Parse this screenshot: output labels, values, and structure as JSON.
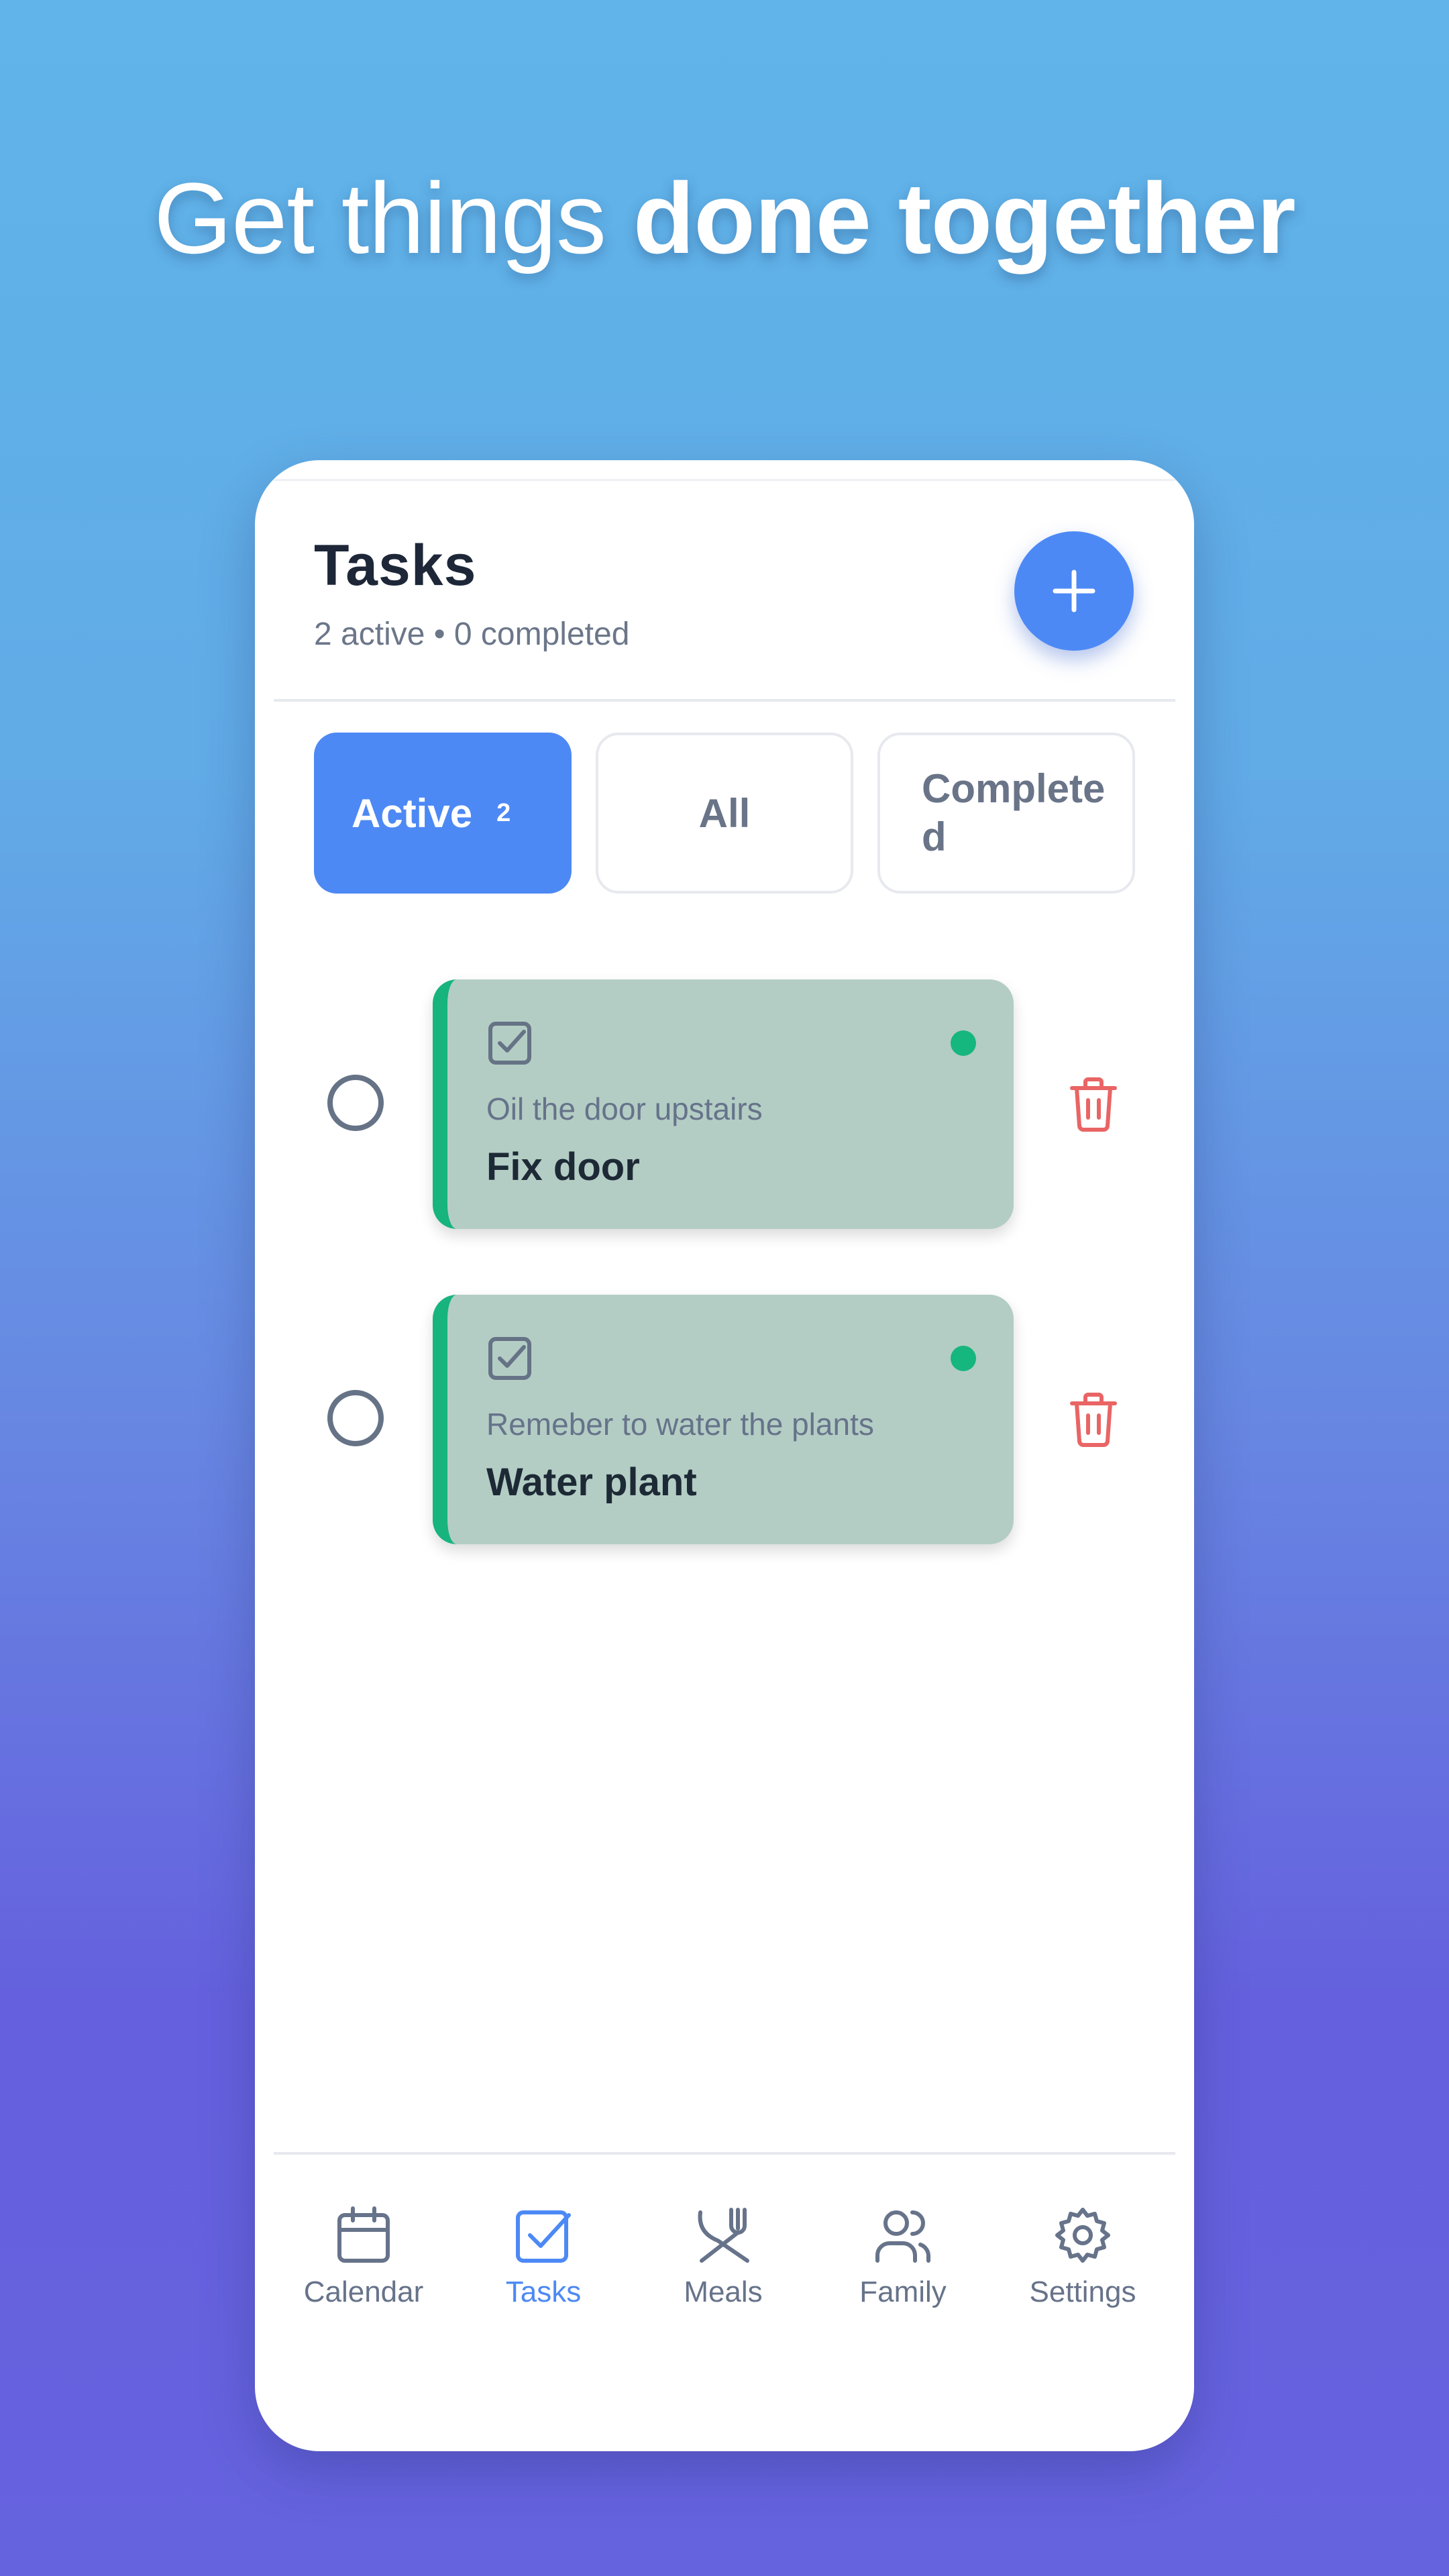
{
  "hero": {
    "light": "Get things",
    "bold": "done together"
  },
  "header": {
    "title": "Tasks",
    "subtitle": "2 active • 0 completed",
    "add_icon": "plus-icon"
  },
  "filters": {
    "active_label": "Active",
    "active_count": "2",
    "all_label": "All",
    "completed_label": "Completed"
  },
  "tasks": [
    {
      "description": "Oil the door upstairs",
      "name": "Fix door",
      "icon": "checkbox-icon",
      "status_color": "#16b67f"
    },
    {
      "description": "Remeber to water the plants",
      "name": "Water plant",
      "icon": "checkbox-icon",
      "status_color": "#16b67f"
    }
  ],
  "nav": [
    {
      "label": "Calendar",
      "icon": "calendar-icon"
    },
    {
      "label": "Tasks",
      "icon": "task-check-icon"
    },
    {
      "label": "Meals",
      "icon": "utensils-crossed-icon"
    },
    {
      "label": "Family",
      "icon": "users-icon"
    },
    {
      "label": "Settings",
      "icon": "gear-icon"
    }
  ],
  "colors": {
    "accent": "#4d89f5",
    "card_bg": "#b3cdc4",
    "card_stripe": "#17b47e",
    "delete": "#e96565",
    "muted": "#66738a",
    "text_dark": "#1e2738"
  }
}
